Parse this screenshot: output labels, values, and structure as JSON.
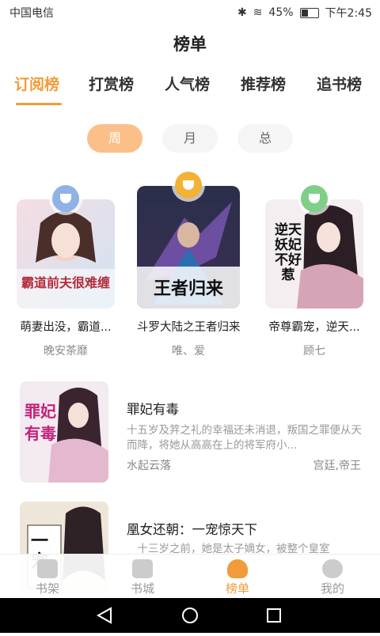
{
  "status": {
    "carrier": "中国电信",
    "battery": "45%",
    "time": "下午2:45"
  },
  "title": "榜单",
  "tabs": [
    "订阅榜",
    "打赏榜",
    "人气榜",
    "推荐榜",
    "追书榜"
  ],
  "periods": [
    "周",
    "月",
    "总"
  ],
  "top3": [
    {
      "title": "萌妻出没，霸道...",
      "author": "晚安茶靡",
      "cover_text": "霸道前夫很难缠",
      "badge_color": "#8fb3e8"
    },
    {
      "title": "斗罗大陆之王者归来",
      "author": "唯、爱",
      "cover_text": "王者归来",
      "badge_color": "#f3b233"
    },
    {
      "title": "帝尊霸宠，逆天...",
      "author": "顾七",
      "cover_text": "逆天妖妃不好惹",
      "badge_color": "#7fcf88"
    }
  ],
  "list": [
    {
      "title": "罪妃有毒",
      "desc": "十五岁及笄之礼的幸福还未消退，叛国之罪便从天而降，将她从高高在上的将军府小...",
      "author": "水起云落",
      "tag": "宫廷,帝王",
      "cover_text": "罪妃有毒"
    },
    {
      "title": "凰女还朝：一宠惊天下",
      "desc": "十三岁之前，她是太子嫡女，被整个皇室",
      "author": "",
      "tag": "",
      "cover_text": "一宠"
    }
  ],
  "nav": [
    "书架",
    "书城",
    "榜单",
    "我的"
  ],
  "colors": {
    "accent": "#f29b3a"
  }
}
